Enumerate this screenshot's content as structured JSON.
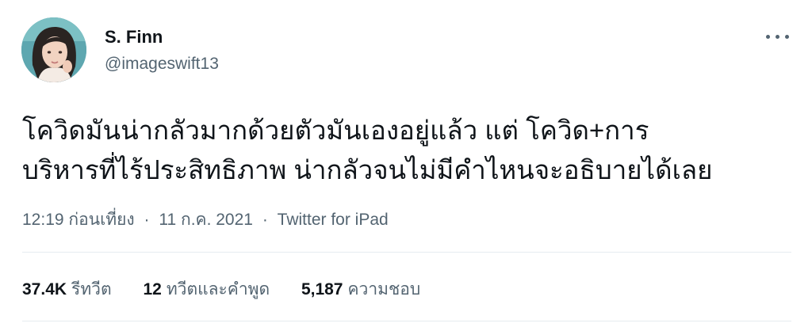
{
  "user": {
    "display_name": "S. Finn",
    "handle": "@imageswift13",
    "avatar_icon": "user-avatar-photo"
  },
  "more_icon": "more-horizontal-icon",
  "tweet": {
    "lines": [
      "โควิดมันน่ากลัวมากด้วยตัวมันเองอยู่แล้ว แต่ โควิด+การ",
      "บริหารที่ไร้ประสิทธิภาพ น่ากลัวจนไม่มีคำไหนจะอธิบายได้เลย"
    ]
  },
  "meta": {
    "time": "12:19 ก่อนเที่ยง",
    "separator": "·",
    "date": "11 ก.ค. 2021",
    "source": "Twitter for iPad"
  },
  "stats": {
    "retweets": {
      "count": "37.4K",
      "label": "รีทวีต"
    },
    "quotes": {
      "count": "12",
      "label": "ทวีตและคำพูด"
    },
    "likes": {
      "count": "5,187",
      "label": "ความชอบ"
    }
  },
  "colors": {
    "primary_text": "#0f1419",
    "secondary_text": "#536471",
    "divider": "#e6ecf0",
    "avatar_bg": "#5ea7b0"
  }
}
